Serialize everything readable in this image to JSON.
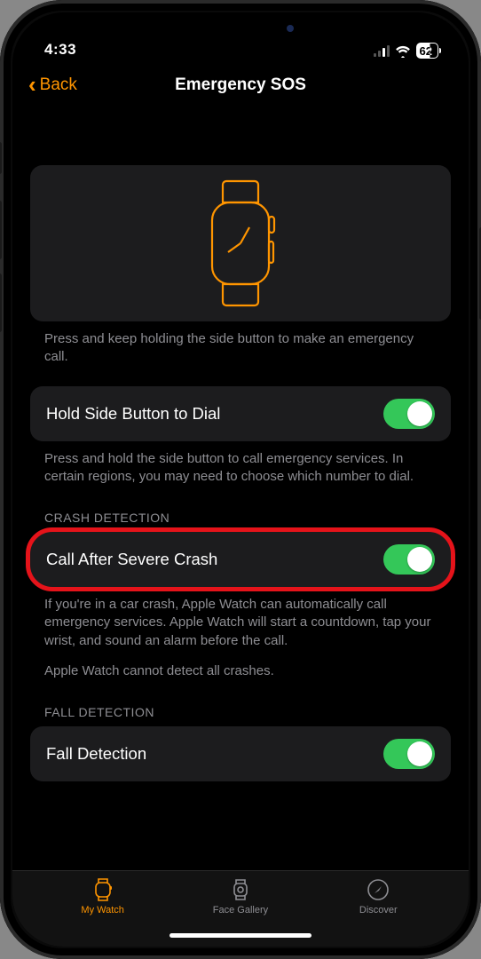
{
  "status": {
    "time": "4:33",
    "battery": "62"
  },
  "nav": {
    "back": "Back",
    "title": "Emergency SOS"
  },
  "hero_help": "Press and keep holding the side button to make an emergency call.",
  "hold_side": {
    "label": "Hold Side Button to Dial",
    "help": "Press and hold the side button to call emergency services. In certain regions, you may need to choose which number to dial.",
    "on": true
  },
  "crash": {
    "header": "CRASH DETECTION",
    "label": "Call After Severe Crash",
    "help": "If you're in a car crash, Apple Watch can automatically call emergency services. Apple Watch will start a countdown, tap your wrist, and sound an alarm before the call.",
    "help2": "Apple Watch cannot detect all crashes.",
    "on": true
  },
  "fall": {
    "header": "FALL DETECTION",
    "label": "Fall Detection",
    "on": true
  },
  "tabs": {
    "watch": "My Watch",
    "gallery": "Face Gallery",
    "discover": "Discover"
  }
}
